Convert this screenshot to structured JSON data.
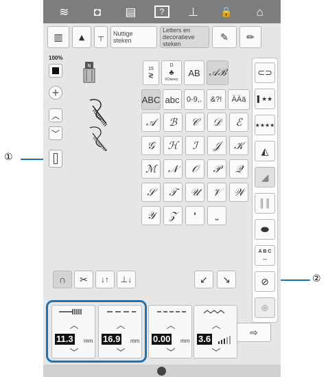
{
  "callouts": {
    "left": "①",
    "right": "②"
  },
  "topbar": {
    "icons": [
      "wifi-icon",
      "camera-icon",
      "document-icon",
      "help-icon",
      "presser-foot-icon",
      "lock-icon",
      "home-icon"
    ],
    "glyphs": [
      "≋",
      "◘",
      "▤",
      "?",
      "⊥",
      "🔒",
      "⌂"
    ]
  },
  "modebar": {
    "useful_stitches": "Nuttige\nsteken",
    "letters_decorative": "Letters en\ndecoratieve\nsteken"
  },
  "left": {
    "zoom": "100%"
  },
  "categories": {
    "row1": [
      "AB"
    ],
    "row2": [
      "ABC",
      "abc",
      "0-9,.",
      "&?!",
      "ÄÄä"
    ],
    "small_label_15": "15",
    "small_label_d": "D",
    "disney_label": "©Disney"
  },
  "grid": {
    "rows": [
      [
        "𝒜",
        "ℬ",
        "𝒞",
        "𝒟",
        "ℰ"
      ],
      [
        "𝒢",
        "ℋ",
        "ℐ",
        "𝒥",
        "𝒦"
      ],
      [
        "ℳ",
        "𝒩",
        "𝒪",
        "𝒫",
        "𝒬"
      ],
      [
        "𝒮",
        "𝒯",
        "𝒰",
        "𝒱",
        "𝒲"
      ],
      [
        "𝒴",
        "𝒵",
        "'",
        "⎵",
        ""
      ]
    ]
  },
  "right_panel": {
    "abc_label": "A B C"
  },
  "settings": [
    {
      "value": "11.3",
      "unit": "mm"
    },
    {
      "value": "16.9",
      "unit": "mm"
    },
    {
      "value": "0.00",
      "unit": "mm"
    },
    {
      "value": "3.6",
      "unit": ""
    }
  ],
  "colors": {
    "accent": "#1a73b8",
    "topbar": "#7d7d7d",
    "screen": "#e6e6e6"
  }
}
